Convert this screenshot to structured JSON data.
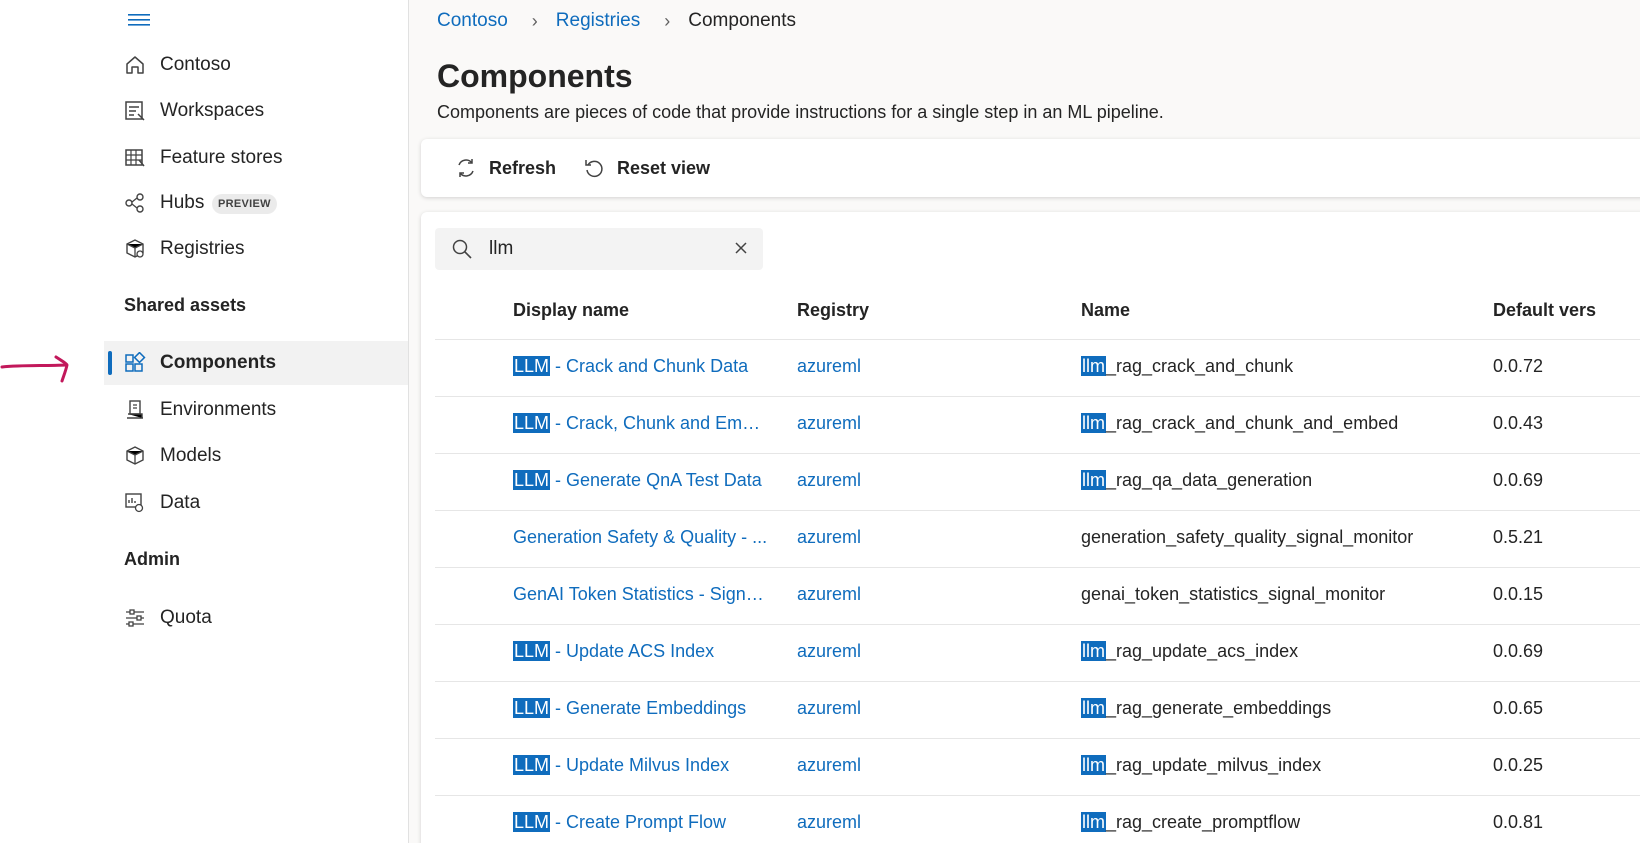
{
  "nav": {
    "items": [
      {
        "label": "Contoso",
        "icon": "home-icon"
      },
      {
        "label": "Workspaces",
        "icon": "workspaces-icon"
      },
      {
        "label": "Feature stores",
        "icon": "feature-stores-icon"
      },
      {
        "label": "Hubs",
        "icon": "hubs-icon",
        "badge": "PREVIEW"
      },
      {
        "label": "Registries",
        "icon": "registries-icon"
      }
    ],
    "shared_assets_title": "Shared assets",
    "shared_items": [
      {
        "label": "Components",
        "icon": "components-icon",
        "active": true
      },
      {
        "label": "Environments",
        "icon": "environments-icon"
      },
      {
        "label": "Models",
        "icon": "models-icon"
      },
      {
        "label": "Data",
        "icon": "data-icon"
      }
    ],
    "admin_title": "Admin",
    "admin_items": [
      {
        "label": "Quota",
        "icon": "quota-icon"
      }
    ]
  },
  "breadcrumb": [
    "Contoso",
    "Registries",
    "Components"
  ],
  "page": {
    "title": "Components",
    "description": "Components are pieces of code that provide instructions for a single step in an ML pipeline."
  },
  "toolbar": {
    "refresh_label": "Refresh",
    "reset_label": "Reset view"
  },
  "search": {
    "value": "llm"
  },
  "table": {
    "columns": [
      "Display name",
      "Registry",
      "Name",
      "Default vers"
    ],
    "rows": [
      {
        "display_hl": "LLM",
        "display_rest": " - Crack and Chunk Data",
        "registry": "azureml",
        "name_hl": "llm",
        "name_rest": "_rag_crack_and_chunk",
        "version": "0.0.72"
      },
      {
        "display_hl": "LLM",
        "display_rest": " - Crack, Chunk and Embe...",
        "registry": "azureml",
        "name_hl": "llm",
        "name_rest": "_rag_crack_and_chunk_and_embed",
        "version": "0.0.43"
      },
      {
        "display_hl": "LLM",
        "display_rest": " - Generate QnA Test Data",
        "registry": "azureml",
        "name_hl": "llm",
        "name_rest": "_rag_qa_data_generation",
        "version": "0.0.69"
      },
      {
        "display_hl": "",
        "display_rest": "Generation Safety & Quality - ...",
        "registry": "azureml",
        "name_hl": "",
        "name_rest": "generation_safety_quality_signal_monitor",
        "version": "0.5.21"
      },
      {
        "display_hl": "",
        "display_rest": "GenAI Token Statistics - Signal ...",
        "registry": "azureml",
        "name_hl": "",
        "name_rest": "genai_token_statistics_signal_monitor",
        "version": "0.0.15"
      },
      {
        "display_hl": "LLM",
        "display_rest": " - Update ACS Index",
        "registry": "azureml",
        "name_hl": "llm",
        "name_rest": "_rag_update_acs_index",
        "version": "0.0.69"
      },
      {
        "display_hl": "LLM",
        "display_rest": " - Generate Embeddings",
        "registry": "azureml",
        "name_hl": "llm",
        "name_rest": "_rag_generate_embeddings",
        "version": "0.0.65"
      },
      {
        "display_hl": "LLM",
        "display_rest": " - Update Milvus Index",
        "registry": "azureml",
        "name_hl": "llm",
        "name_rest": "_rag_update_milvus_index",
        "version": "0.0.25"
      },
      {
        "display_hl": "LLM",
        "display_rest": " - Create Prompt Flow",
        "registry": "azureml",
        "name_hl": "llm",
        "name_rest": "_rag_create_promptflow",
        "version": "0.0.81"
      }
    ]
  },
  "colors": {
    "accent": "#0f6cbd",
    "annotation_arrow": "#c2185b"
  }
}
